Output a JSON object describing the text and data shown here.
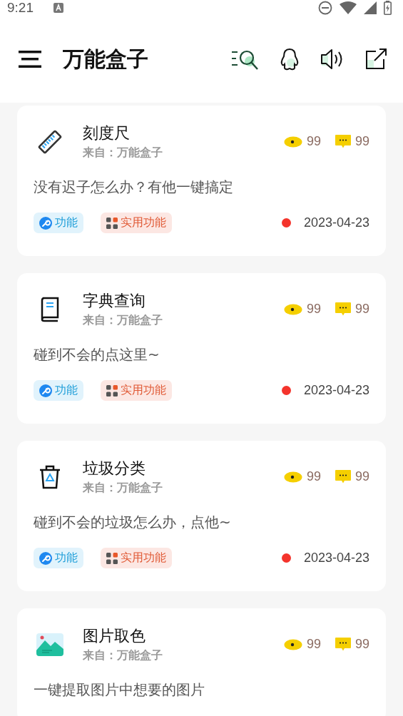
{
  "status_bar": {
    "time": "9:21"
  },
  "header": {
    "title": "万能盒子"
  },
  "cards": [
    {
      "kind": "ruler",
      "title": "刻度尺",
      "source": "来自：万能盒子",
      "views": "99",
      "comments": "99",
      "description": "没有迟子怎么办？有他一键搞定",
      "tags": [
        {
          "kind": "feature",
          "label": "功能"
        },
        {
          "kind": "utility",
          "label": "实用功能"
        }
      ],
      "date": "2023-04-23",
      "color": "#f4342c"
    },
    {
      "kind": "book",
      "title": "字典查询",
      "source": "来自：万能盒子",
      "views": "99",
      "comments": "99",
      "description": "碰到不会的点这里~",
      "tags": [
        {
          "kind": "feature",
          "label": "功能"
        },
        {
          "kind": "utility",
          "label": "实用功能"
        }
      ],
      "date": "2023-04-23",
      "color": "#f4342c"
    },
    {
      "kind": "trash",
      "title": "垃圾分类",
      "source": "来自：万能盒子",
      "views": "99",
      "comments": "99",
      "description": "碰到不会的垃圾怎么办，点他~",
      "tags": [
        {
          "kind": "feature",
          "label": "功能"
        },
        {
          "kind": "utility",
          "label": "实用功能"
        }
      ],
      "date": "2023-04-23",
      "color": "#f4342c"
    },
    {
      "kind": "image",
      "title": "图片取色",
      "source": "来自：万能盒子",
      "views": "99",
      "comments": "99",
      "description": "一键提取图片中想要的图片"
    }
  ]
}
